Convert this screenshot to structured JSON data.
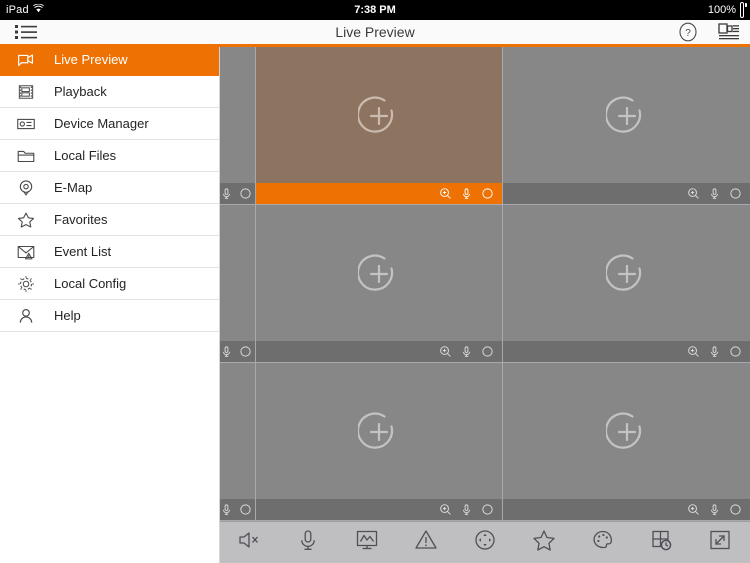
{
  "status_bar": {
    "carrier": "iPad",
    "wifi_icon": "wifi-icon",
    "time": "7:38 PM",
    "battery_percent": "100%",
    "battery_icon": "battery-full-icon"
  },
  "nav_bar": {
    "menu_icon": "list-menu-icon",
    "title": "Live Preview",
    "help_icon": "question-circle-icon",
    "device_list_icon": "device-list-icon"
  },
  "accent_color": "#ee7203",
  "sidebar": {
    "items": [
      {
        "label": "Live Preview",
        "icon": "live-preview-icon",
        "active": true
      },
      {
        "label": "Playback",
        "icon": "film-strip-icon",
        "active": false
      },
      {
        "label": "Device Manager",
        "icon": "device-manager-icon",
        "active": false
      },
      {
        "label": "Local Files",
        "icon": "folder-icon",
        "active": false
      },
      {
        "label": "E-Map",
        "icon": "map-pin-icon",
        "active": false
      },
      {
        "label": "Favorites",
        "icon": "star-icon",
        "active": false
      },
      {
        "label": "Event List",
        "icon": "event-envelope-icon",
        "active": false
      },
      {
        "label": "Local Config",
        "icon": "gear-icon",
        "active": false
      },
      {
        "label": "Help",
        "icon": "person-icon",
        "active": false
      }
    ]
  },
  "grid": {
    "rows": 3,
    "columns": 2,
    "partial_column_left": true,
    "cell_add_icon": "add-camera-icon",
    "cell_toolbar_icons": [
      "zoom-in-icon",
      "microphone-icon",
      "record-circle-icon"
    ],
    "selected_cell": {
      "row": 0,
      "column": 0
    },
    "colors": {
      "cell_background": "#878787",
      "cell_selected_background": "#8d7461",
      "cell_toolbar": "#6e6e6e",
      "cell_toolbar_selected": "#ee7203",
      "grid_gap": "#a9a9ad"
    }
  },
  "bottom_toolbar": {
    "buttons": [
      {
        "name": "audio-mute-button",
        "icon": "speaker-muted-icon"
      },
      {
        "name": "talk-button",
        "icon": "microphone-icon"
      },
      {
        "name": "stream-button",
        "icon": "monitor-wave-icon"
      },
      {
        "name": "alarm-button",
        "icon": "warning-triangle-icon"
      },
      {
        "name": "ptz-button",
        "icon": "ptz-control-icon"
      },
      {
        "name": "favorites-button",
        "icon": "star-icon"
      },
      {
        "name": "image-adjust-button",
        "icon": "palette-icon"
      },
      {
        "name": "layout-button",
        "icon": "layout-clock-icon"
      },
      {
        "name": "fullscreen-button",
        "icon": "expand-arrows-icon"
      }
    ],
    "background_color": "#bfbfc2"
  }
}
